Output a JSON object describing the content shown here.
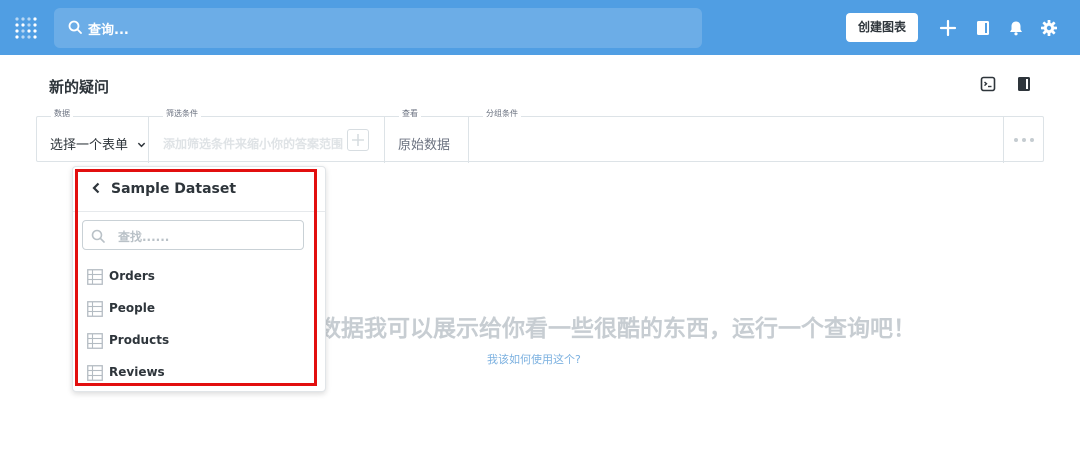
{
  "nav": {
    "search_placeholder": "查询...",
    "create_chart": "创建图表"
  },
  "header": {
    "title": "新的疑问"
  },
  "query_builder": {
    "data_label": "数据",
    "data_value": "选择一个表单",
    "filter_label": "筛选条件",
    "filter_placeholder": "添加筛选条件来缩小你的答案范围",
    "view_label": "查看",
    "view_value": "原始数据",
    "group_label": "分组条件"
  },
  "popover": {
    "dataset_name": "Sample Dataset",
    "search_placeholder": "查找......",
    "tables": [
      "Orders",
      "People",
      "Products",
      "Reviews"
    ]
  },
  "empty_state": {
    "message": "数据我可以展示给你看一些很酷的东西，运行一个查询吧！",
    "help_link": "我该如何使用这个?"
  },
  "colors": {
    "brand": "#509ee3",
    "highlight": "#e20f0f"
  }
}
